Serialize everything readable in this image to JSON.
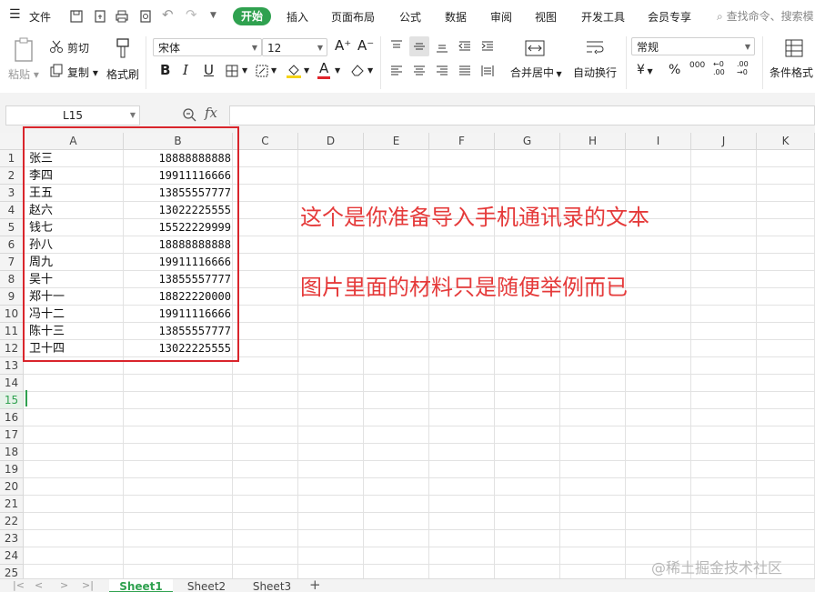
{
  "menubar": {
    "file_label": "文件",
    "tabs": [
      "开始",
      "插入",
      "页面布局",
      "公式",
      "数据",
      "审阅",
      "视图",
      "开发工具",
      "会员专享"
    ],
    "search_placeholder": "查找命令、搜索模"
  },
  "ribbon": {
    "paste_label": "粘贴",
    "cut_label": "剪切",
    "copy_label": "复制",
    "format_painter_label": "格式刷",
    "font_name": "宋体",
    "font_size": "12",
    "merge_label": "合并居中",
    "wrap_label": "自动换行",
    "number_format": "常规",
    "conditional_label": "条件格式",
    "yen_symbol": "¥",
    "percent_symbol": "%",
    "thousands_symbol": "000",
    "dec_increase": "←0 .00",
    "dec_decrease": ".00 →0",
    "bold": "B",
    "italic": "I",
    "underline": "U",
    "font_grow": "A⁺",
    "font_shrink": "A⁻",
    "font_color_accent": "#e0242b",
    "fill_color_accent": "#f5d317"
  },
  "formula_bar": {
    "name_box": "L15",
    "fx_label": "fx"
  },
  "grid": {
    "columns": [
      "A",
      "B",
      "C",
      "D",
      "E",
      "F",
      "G",
      "H",
      "I",
      "J",
      "K"
    ],
    "rows": [
      "1",
      "2",
      "3",
      "4",
      "5",
      "6",
      "7",
      "8",
      "9",
      "10",
      "11",
      "12",
      "13",
      "14",
      "15",
      "16",
      "17",
      "18",
      "19",
      "20",
      "21",
      "22",
      "23",
      "24",
      "25"
    ],
    "active_row": "15",
    "data": [
      {
        "name": "张三",
        "phone": "18888888888"
      },
      {
        "name": "李四",
        "phone": "19911116666"
      },
      {
        "name": "王五",
        "phone": "13855557777"
      },
      {
        "name": "赵六",
        "phone": "13022225555"
      },
      {
        "name": "钱七",
        "phone": "15522229999"
      },
      {
        "name": "孙八",
        "phone": "18888888888"
      },
      {
        "name": "周九",
        "phone": "19911116666"
      },
      {
        "name": "吴十",
        "phone": "13855557777"
      },
      {
        "name": "郑十一",
        "phone": "18822220000"
      },
      {
        "name": "冯十二",
        "phone": "19911116666"
      },
      {
        "name": "陈十三",
        "phone": "13855557777"
      },
      {
        "name": "卫十四",
        "phone": "13022225555"
      }
    ]
  },
  "annotations": {
    "line1": "这个是你准备导入手机通讯录的文本",
    "line2": "图片里面的材料只是随便举例而已",
    "color": "#e53a3a"
  },
  "sheet_tabs": [
    "Sheet1",
    "Sheet2",
    "Sheet3"
  ],
  "add_sheet": "+",
  "watermark": "@稀土掘金技术社区",
  "colors": {
    "accent_green": "#2fa14f",
    "highlight_red": "#d9252c"
  }
}
